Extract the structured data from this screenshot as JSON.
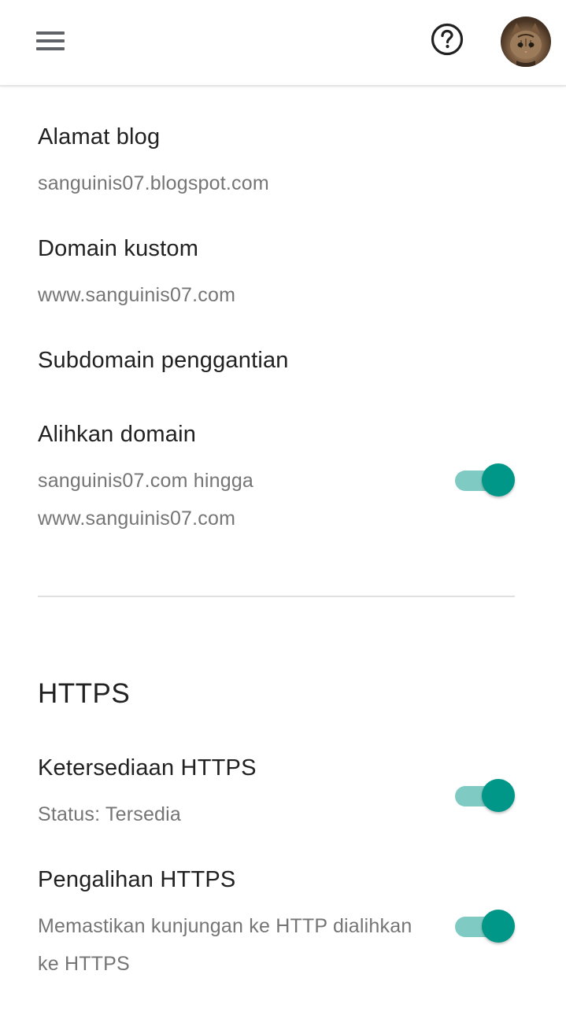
{
  "colors": {
    "accent": "#009688",
    "accent_track": "#7fcbc3",
    "title_text": "#212121",
    "secondary_text": "#757575"
  },
  "header": {
    "menu_icon": "hamburger-menu-icon",
    "help_icon": "help-circle-icon",
    "avatar": "cat-avatar"
  },
  "settings": {
    "blog_address": {
      "title": "Alamat blog",
      "value": "sanguinis07.blogspot.com"
    },
    "custom_domain": {
      "title": "Domain kustom",
      "value": "www.sanguinis07.com"
    },
    "fallback_subdomain": {
      "title": "Subdomain penggantian"
    },
    "redirect_domain": {
      "title": "Alihkan domain",
      "line1": "sanguinis07.com hingga",
      "line2": "www.sanguinis07.com",
      "enabled": true
    }
  },
  "https": {
    "section_title": "HTTPS",
    "availability": {
      "title": "Ketersediaan HTTPS",
      "status": "Status: Tersedia",
      "enabled": true
    },
    "redirect": {
      "title": "Pengalihan HTTPS",
      "line1": "Memastikan kunjungan ke HTTP dialihkan",
      "line2": "ke HTTPS",
      "enabled": true
    }
  }
}
